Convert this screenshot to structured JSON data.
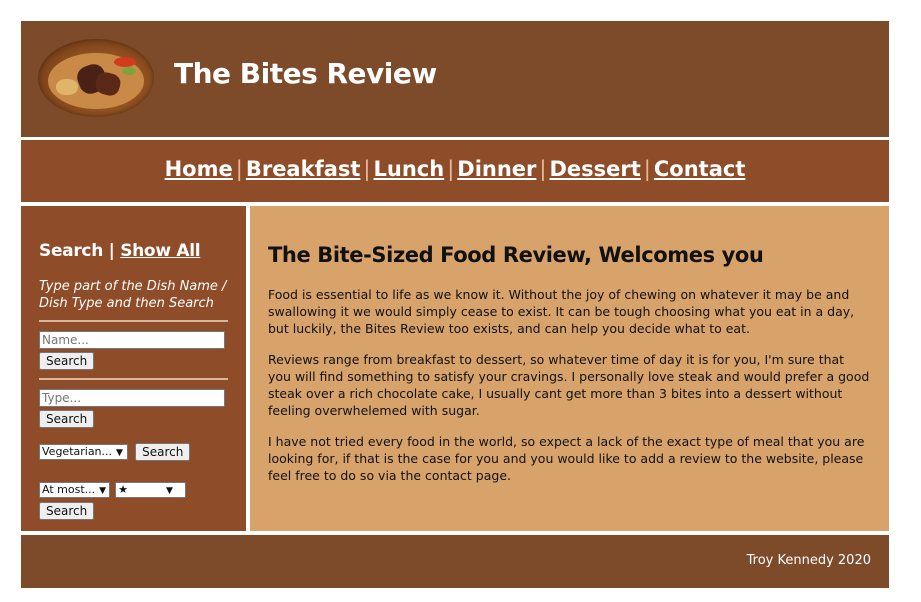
{
  "header": {
    "title": "The Bites Review",
    "logo_icon": "steak-dish-image"
  },
  "nav": {
    "items": [
      "Home",
      "Breakfast",
      "Lunch",
      "Dinner",
      "Dessert",
      "Contact"
    ],
    "separator": "|"
  },
  "sidebar": {
    "search_label": "Search",
    "separator": "|",
    "show_all_label": "Show All",
    "instructions": "Type part of the Dish Name / Dish Type and then Search",
    "name_placeholder": "Name...",
    "name_search_button": "Search",
    "type_placeholder": "Type...",
    "type_search_button": "Search",
    "diet_select_value": "Vegetarian...",
    "diet_search_button": "Search",
    "at_most_select_value": "At most...",
    "rating_select_value": "★",
    "rating_search_button": "Search"
  },
  "main": {
    "heading": "The Bite-Sized Food Review, Welcomes you",
    "paragraphs": [
      "Food is essential to life as we know it. Without the joy of chewing on whatever it may be and swallowing it we would simply cease to exist. It can be tough choosing what you eat in a day, but luckily, the Bites Review too exists, and can help you decide what to eat.",
      "Reviews range from breakfast to dessert, so whatever time of day it is for you, I'm sure that you will find something to satisfy your cravings. I personally love steak and would prefer a good steak over a rich chocolate cake, I usually cant get more than 3 bites into a dessert without feeling overwhelemed with sugar.",
      "I have not tried every food in the world, so expect a lack of the exact type of meal that you are looking for, if that is the case for you and you would like to add a review to the website, please feel free to do so via the contact page."
    ]
  },
  "footer": {
    "credit": "Troy Kennedy 2020"
  },
  "colors": {
    "header_bg": "#7d4a2a",
    "nav_bg": "#8f4c28",
    "content_bg": "#d8a36a"
  }
}
